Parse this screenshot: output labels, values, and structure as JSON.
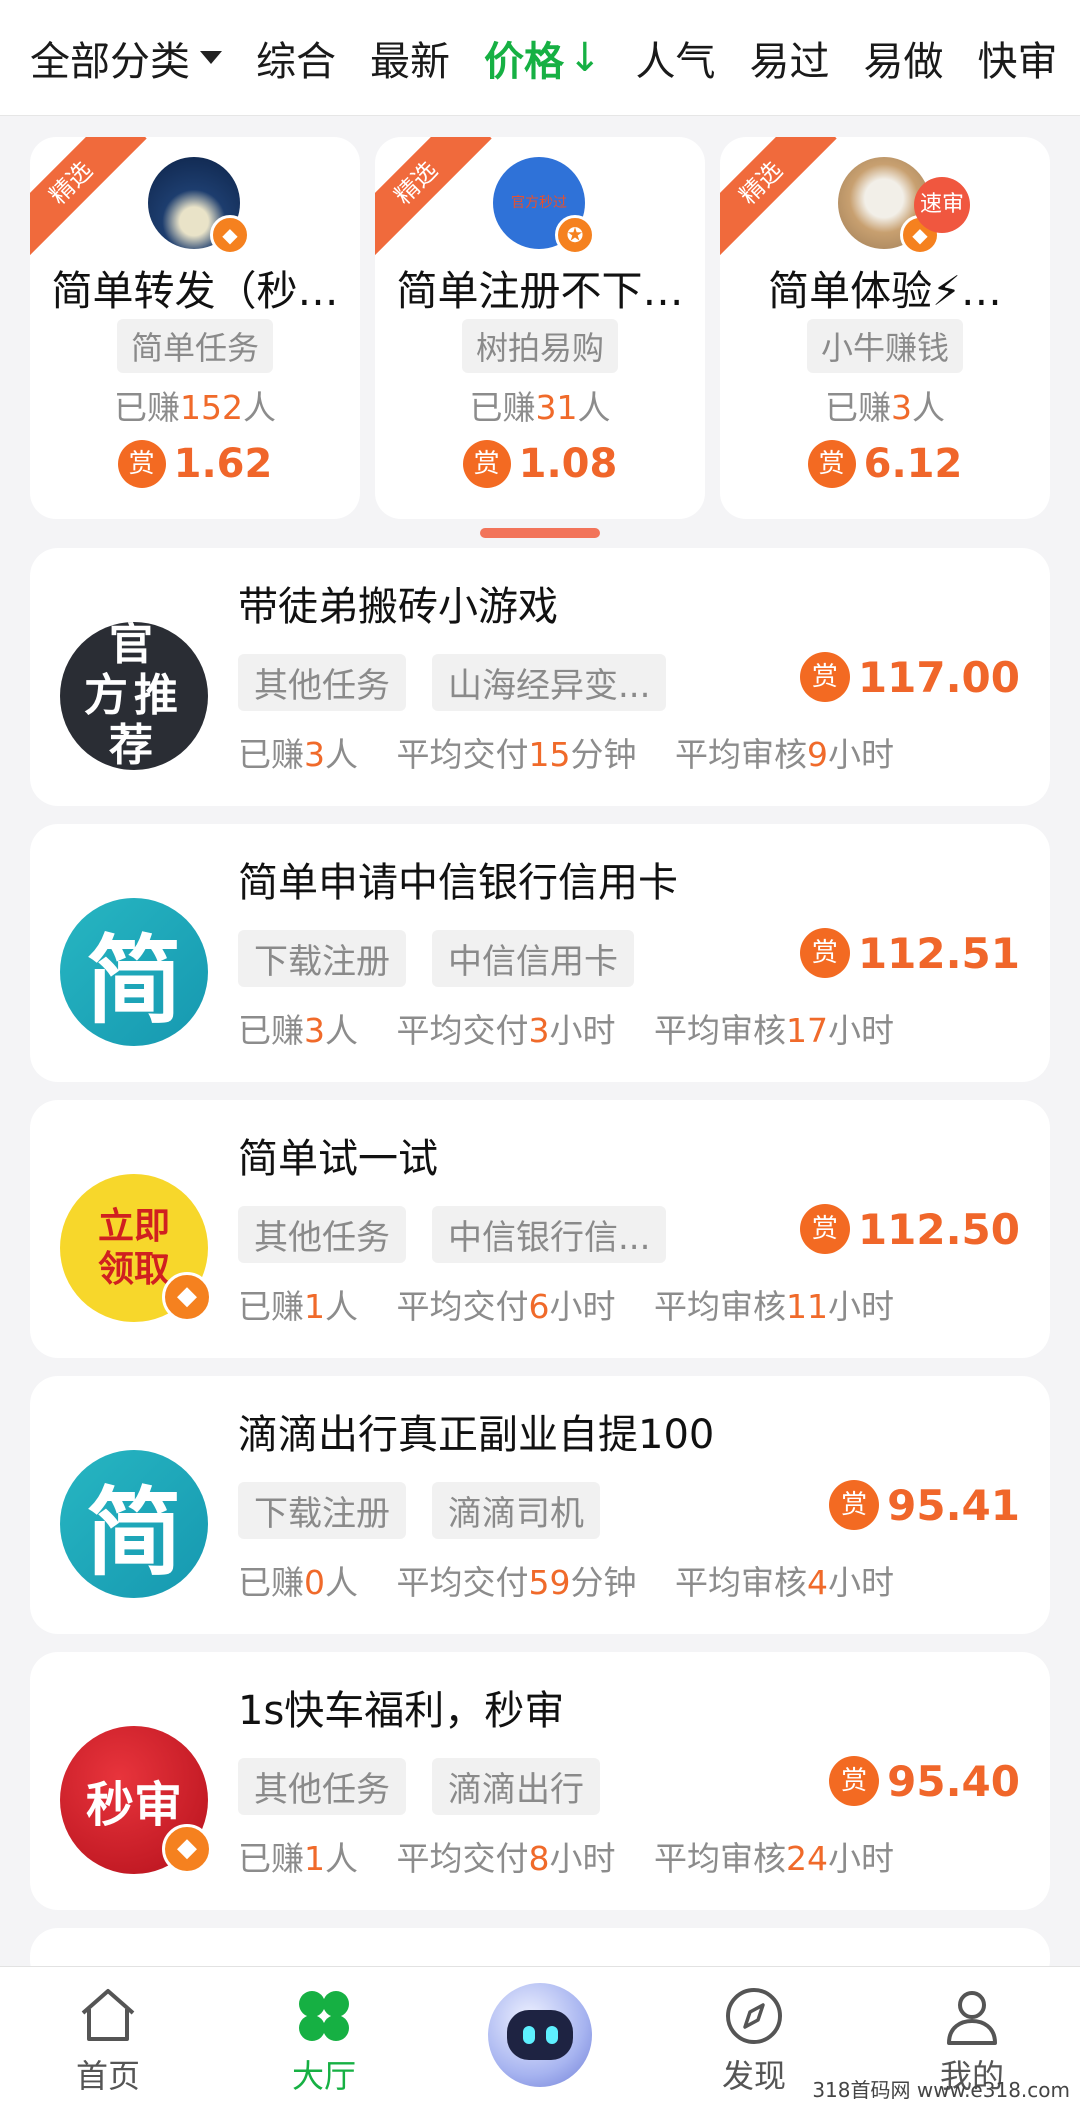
{
  "filter": {
    "all_categories": "全部分类",
    "tabs": [
      "综合",
      "最新",
      "价格",
      "人气",
      "易过",
      "易做",
      "快审"
    ],
    "active_arrow": "↓"
  },
  "featured": [
    {
      "ribbon": "精选",
      "title": "简单转发（秒…",
      "tag": "简单任务",
      "earned_prefix": "已赚",
      "earned_num": "152",
      "earned_suffix": "人",
      "reward_icon": "赏",
      "amount": "1.62"
    },
    {
      "ribbon": "精选",
      "title": "简单注册不下…",
      "tag": "树拍易购",
      "earned_prefix": "已赚",
      "earned_num": "31",
      "earned_suffix": "人",
      "reward_icon": "赏",
      "amount": "1.08",
      "avatar_text": "官方秒过"
    },
    {
      "ribbon": "精选",
      "title": "简单体验⚡…",
      "tag": "小牛赚钱",
      "earned_prefix": "已赚",
      "earned_num": "3",
      "earned_suffix": "人",
      "reward_icon": "赏",
      "amount": "6.12",
      "fast_badge": "速审"
    }
  ],
  "tasks": [
    {
      "logo_text": "官 方推 荐",
      "title": "带徒弟搬砖小游戏",
      "tags": [
        "其他任务",
        "山海经异变..."
      ],
      "earned": "3",
      "delivery_num": "15",
      "delivery_unit": "分钟",
      "review_num": "9",
      "review_unit": "小时",
      "amount": "117.00"
    },
    {
      "logo_text": "简",
      "title": "简单申请中信银行信用卡",
      "tags": [
        "下载注册",
        "中信信用卡"
      ],
      "earned": "3",
      "delivery_num": "3",
      "delivery_unit": "小时",
      "review_num": "17",
      "review_unit": "小时",
      "amount": "112.51"
    },
    {
      "logo_text": "立即领取",
      "title": "简单试一试",
      "tags": [
        "其他任务",
        "中信银行信..."
      ],
      "earned": "1",
      "delivery_num": "6",
      "delivery_unit": "小时",
      "review_num": "11",
      "review_unit": "小时",
      "amount": "112.50"
    },
    {
      "logo_text": "简",
      "title": "滴滴出行真正副业自提100",
      "tags": [
        "下载注册",
        "滴滴司机"
      ],
      "earned": "0",
      "delivery_num": "59",
      "delivery_unit": "分钟",
      "review_num": "4",
      "review_unit": "小时",
      "amount": "95.41"
    },
    {
      "logo_text": "秒审",
      "title": "1s快车福利，秒审",
      "tags": [
        "其他任务",
        "滴滴出行"
      ],
      "earned": "1",
      "delivery_num": "8",
      "delivery_unit": "小时",
      "review_num": "24",
      "review_unit": "小时",
      "amount": "95.40"
    }
  ],
  "labels": {
    "earned_prefix": "已赚",
    "person": "人",
    "avg_delivery": "平均交付",
    "avg_review": "平均审核",
    "reward_icon": "赏"
  },
  "tabbar": {
    "home": "首页",
    "hall": "大厅",
    "discover": "发现",
    "mine": "我的"
  },
  "watermark": "318首码网 www.e318.com",
  "colors": {
    "accent_green": "#16b043",
    "reward_orange": "#f0662a",
    "ribbon": "#f06a3c"
  }
}
